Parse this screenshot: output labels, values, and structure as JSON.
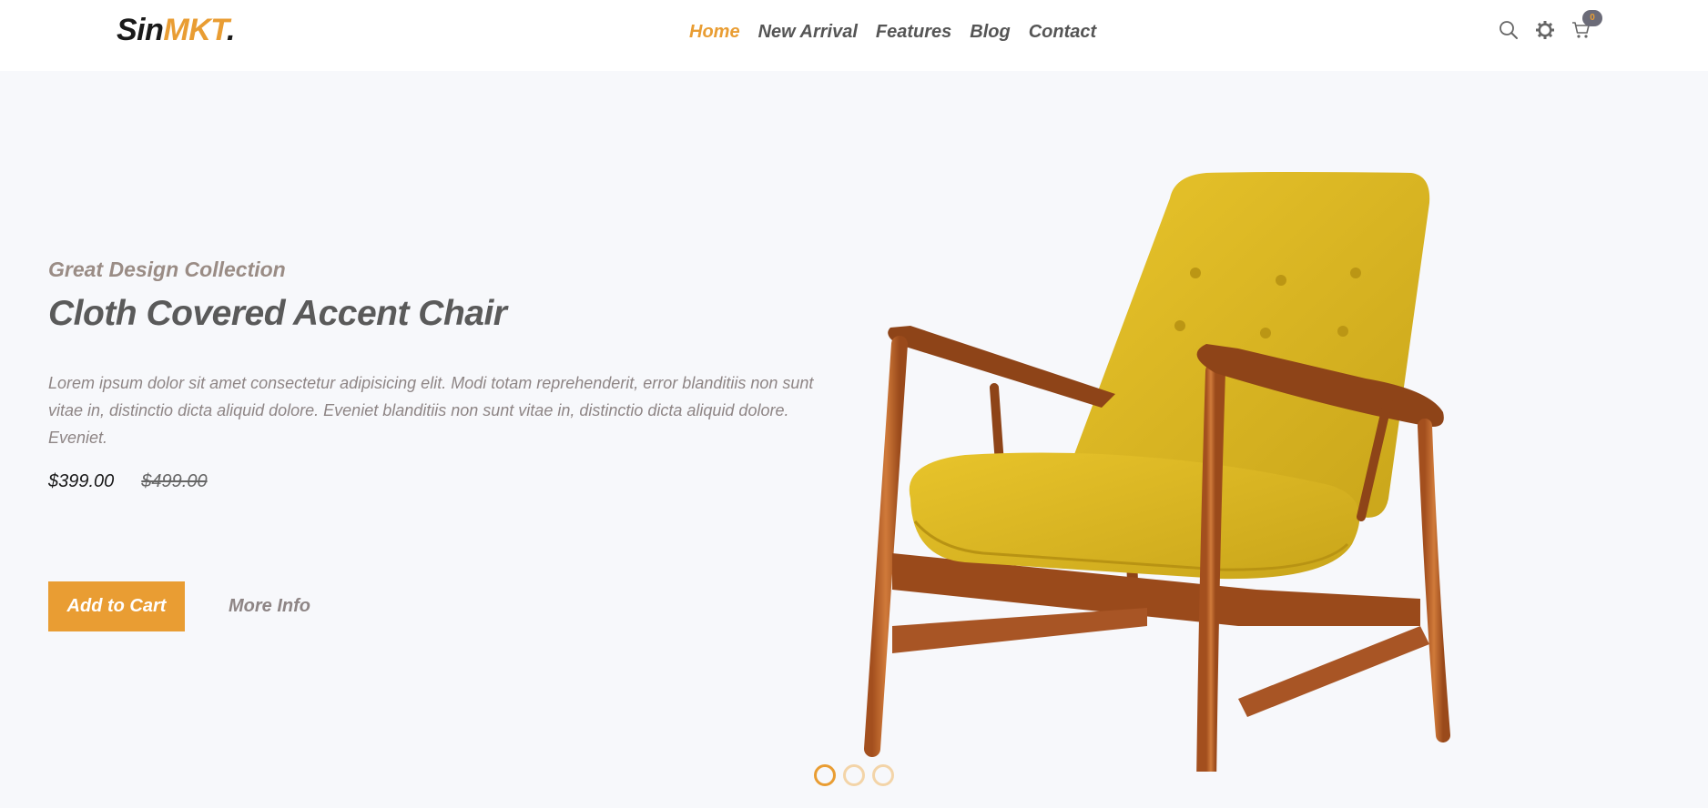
{
  "header": {
    "logo": {
      "part1": "Sin",
      "part2": "MKT",
      "part3": "."
    },
    "nav": [
      {
        "label": "Home",
        "active": true
      },
      {
        "label": "New Arrival",
        "active": false
      },
      {
        "label": "Features",
        "active": false
      },
      {
        "label": "Blog",
        "active": false
      },
      {
        "label": "Contact",
        "active": false
      }
    ],
    "icons": [
      "search-icon",
      "gear-icon",
      "cart-icon"
    ],
    "cart_count": "0"
  },
  "hero": {
    "subtitle": "Great Design Collection",
    "title": "Cloth Covered Accent Chair",
    "description": "Lorem ipsum dolor sit amet consectetur adipisicing elit. Modi totam reprehenderit, error blanditiis non sunt vitae in, distinctio dicta aliquid dolore. Eveniet blanditiis non sunt vitae in, distinctio dicta aliquid dolore. Eveniet.",
    "price": "$399.00",
    "old_price": "$499.00",
    "add_to_cart_label": "Add to Cart",
    "more_info_label": "More Info",
    "slides_total": 3,
    "slide_active": 1
  },
  "colors": {
    "accent": "#e99d33",
    "hero_bg": "#f7f8fb",
    "text_dark": "#5a5a5a",
    "text_muted": "#8e8585"
  }
}
